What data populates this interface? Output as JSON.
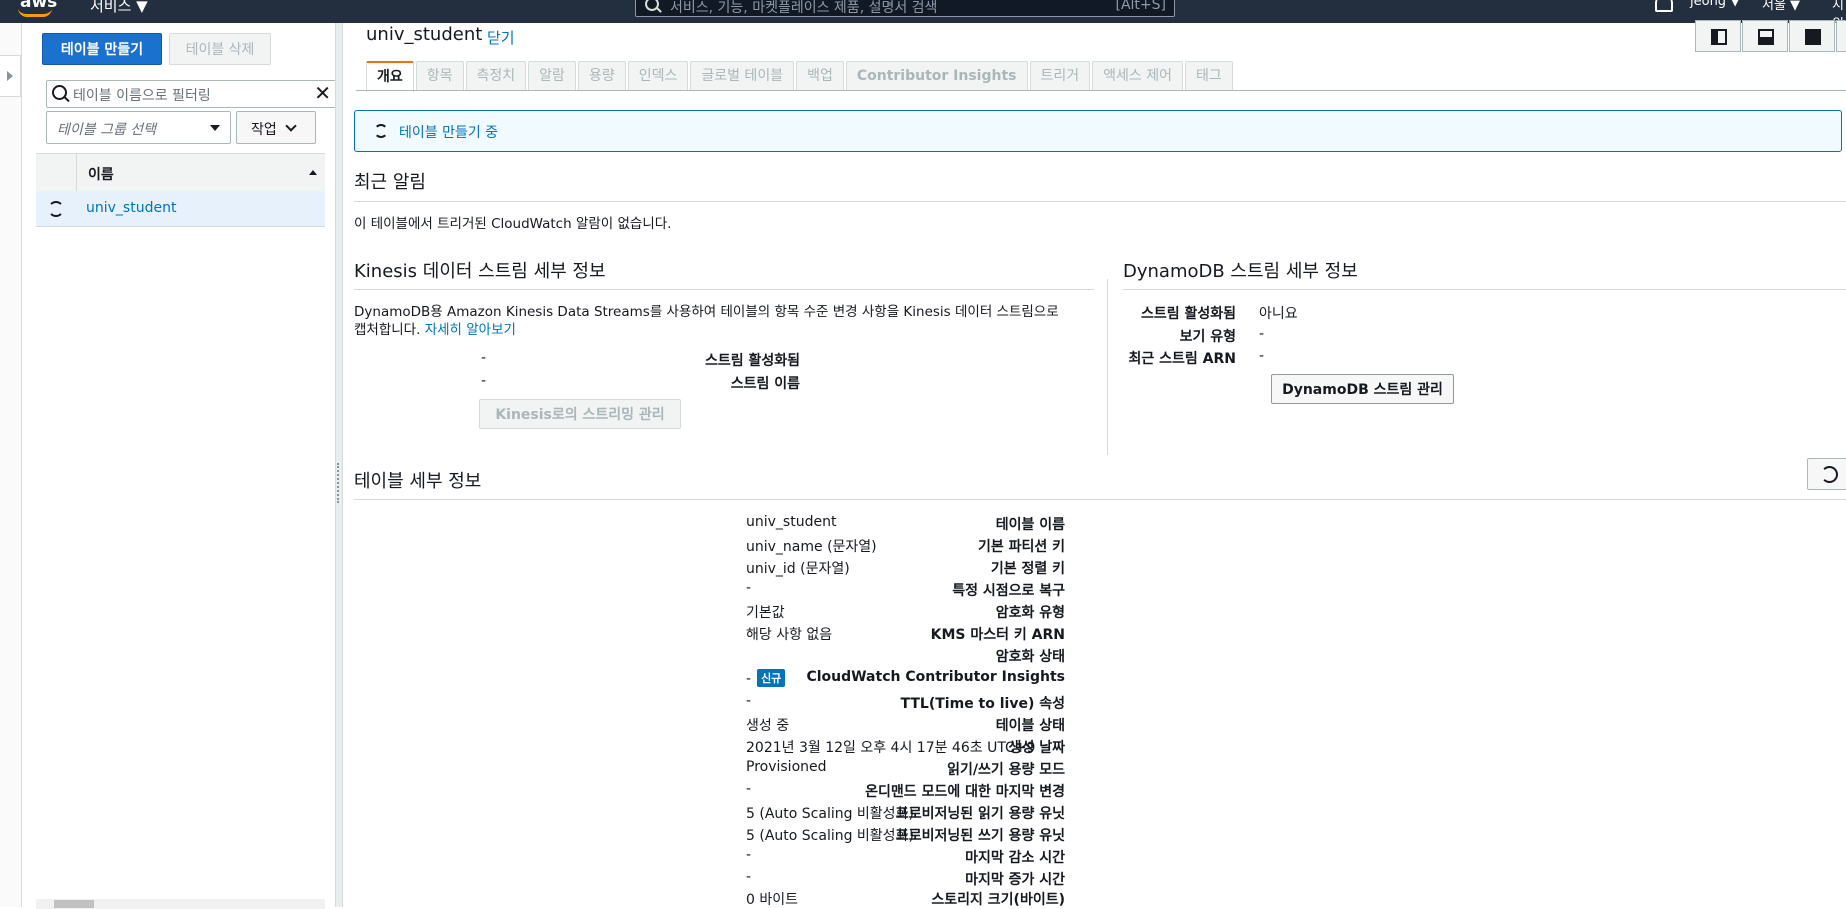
{
  "topnav": {
    "logo": "aws",
    "services": "서비스 ▼",
    "search_placeholder": "서비스, 기능, 마켓플레이스 제품, 설명서 검색",
    "search_shortcut": "[Alt+S]",
    "user": "jeong ▼",
    "region": "서울 ▼",
    "support": "지원"
  },
  "list": {
    "create_button": "테이블 만들기",
    "delete_button": "테이블 삭제",
    "filter_placeholder": "테이블 이름으로 필터링",
    "group_placeholder": "테이블 그룹 선택",
    "action_button": "작업",
    "column_name": "이름",
    "rows": [
      {
        "name": "univ_student"
      }
    ]
  },
  "detail": {
    "title": "univ_student",
    "close": "닫기",
    "tabs": [
      "개요",
      "항목",
      "측정치",
      "알람",
      "용량",
      "인덱스",
      "글로벌 테이블",
      "백업",
      "Contributor Insights",
      "트리거",
      "액세스 제어",
      "태그"
    ],
    "banner": "테이블 만들기 중",
    "alarms": {
      "title": "최근 알림",
      "message": "이 테이블에서 트리거된 CloudWatch 알람이 없습니다."
    },
    "kinesis": {
      "title": "Kinesis 데이터 스트림 세부 정보",
      "description": "DynamoDB용 Amazon Kinesis Data Streams를 사용하여 테이블의 항목 수준 변경 사항을 Kinesis 데이터 스트림으로",
      "description2": "캡처합니다.",
      "learn_more": "자세히 알아보기",
      "fields": [
        {
          "key": "스트림 활성화됨",
          "value": "-"
        },
        {
          "key": "스트림 이름",
          "value": "-"
        }
      ],
      "manage_button": "Kinesis로의 스트리밍 관리"
    },
    "dynamo_stream": {
      "title": "DynamoDB 스트림 세부 정보",
      "fields": [
        {
          "key": "스트림 활성화됨",
          "value": "아니요"
        },
        {
          "key": "보기 유형",
          "value": "-"
        },
        {
          "key": "최근 스트림 ARN",
          "value": "-"
        }
      ],
      "manage_button": "DynamoDB 스트림 관리"
    },
    "table_details": {
      "title": "테이블 세부 정보",
      "new_badge": "신규",
      "fields": [
        {
          "key": "테이블 이름",
          "value": "univ_student"
        },
        {
          "key": "기본 파티션 키",
          "value": "univ_name (문자열)"
        },
        {
          "key": "기본 정렬 키",
          "value": "univ_id (문자열)"
        },
        {
          "key": "특정 시점으로 복구",
          "value": "-"
        },
        {
          "key": "암호화 유형",
          "value": "기본값"
        },
        {
          "key": "KMS 마스터 키 ARN",
          "value": "해당 사항 없음"
        },
        {
          "key": "암호화 상태",
          "value": ""
        },
        {
          "key": "CloudWatch Contributor Insights",
          "value": "-"
        },
        {
          "key": "TTL(Time to live) 속성",
          "value": "-"
        },
        {
          "key": "테이블 상태",
          "value": "생성 중"
        },
        {
          "key": "생성 날짜",
          "value": "2021년 3월 12일 오후 4시 17분 46초 UTC+9"
        },
        {
          "key": "읽기/쓰기 용량 모드",
          "value": "Provisioned"
        },
        {
          "key": "온디맨드 모드에 대한 마지막 변경",
          "value": "-"
        },
        {
          "key": "프로비저닝된 읽기 용량 유닛",
          "value": "5 (Auto Scaling 비활성화)"
        },
        {
          "key": "프로비저닝된 쓰기 용량 유닛",
          "value": "5 (Auto Scaling 비활성화)"
        },
        {
          "key": "마지막 감소 시간",
          "value": "-"
        },
        {
          "key": "마지막 증가 시간",
          "value": "-"
        },
        {
          "key": "스토리지 크기(바이트)",
          "value": "0 바이트"
        }
      ]
    }
  },
  "colors": {
    "nav_bg": "#232f3e",
    "primary": "#1a72ce",
    "link": "#0073bb",
    "active_tab": "#ec7211"
  }
}
